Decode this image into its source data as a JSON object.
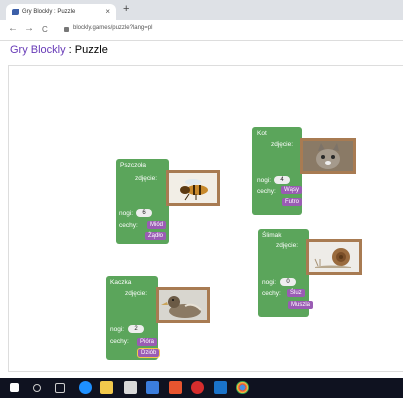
{
  "browser": {
    "tab_title": "Gry Blockly : Puzzle",
    "close_glyph": "×",
    "new_tab_glyph": "+",
    "back_glyph": "←",
    "forward_glyph": "→",
    "reload_glyph": "C",
    "url": "blockly.games/puzzle?lang=pl"
  },
  "page": {
    "app_name": "Gry Blockly",
    "separator": " : ",
    "title": "Puzzle"
  },
  "blocks": {
    "pszczola": {
      "name": "Pszczoła",
      "picture_label": "zdjęcie:",
      "legs_label": "nogi:",
      "legs_value": "6",
      "traits_label": "cechy:",
      "traits": [
        "Miód",
        "Żądło"
      ]
    },
    "kot": {
      "name": "Kot",
      "picture_label": "zdjęcie:",
      "legs_label": "nogi:",
      "legs_value": "4",
      "traits_label": "cechy:",
      "traits": [
        "Wąsy",
        "Futro"
      ]
    },
    "kaczka": {
      "name": "Kaczka",
      "picture_label": "zdjęcie:",
      "legs_label": "nogi:",
      "legs_value": "2",
      "traits_label": "cechy:",
      "traits": [
        "Pióra",
        "Dziób"
      ]
    },
    "slimak": {
      "name": "Ślimak",
      "picture_label": "zdjęcie:",
      "legs_label": "nogi:",
      "legs_value": "0",
      "traits_label": "cechy:",
      "traits": [
        "Śluz",
        "Muszla"
      ]
    }
  },
  "taskbar": {
    "icons": [
      "windows-start-icon",
      "search-icon",
      "task-view-icon",
      "edge-icon",
      "file-explorer-icon",
      "store-icon",
      "mail-icon",
      "office-icon",
      "opera-icon",
      "outlook-icon",
      "chrome-icon"
    ]
  },
  "colors": {
    "block_green": "#5ba55b",
    "trait_purple": "#9a5cb4",
    "photo_frame": "#a87b52",
    "link_purple": "#673ab7"
  }
}
